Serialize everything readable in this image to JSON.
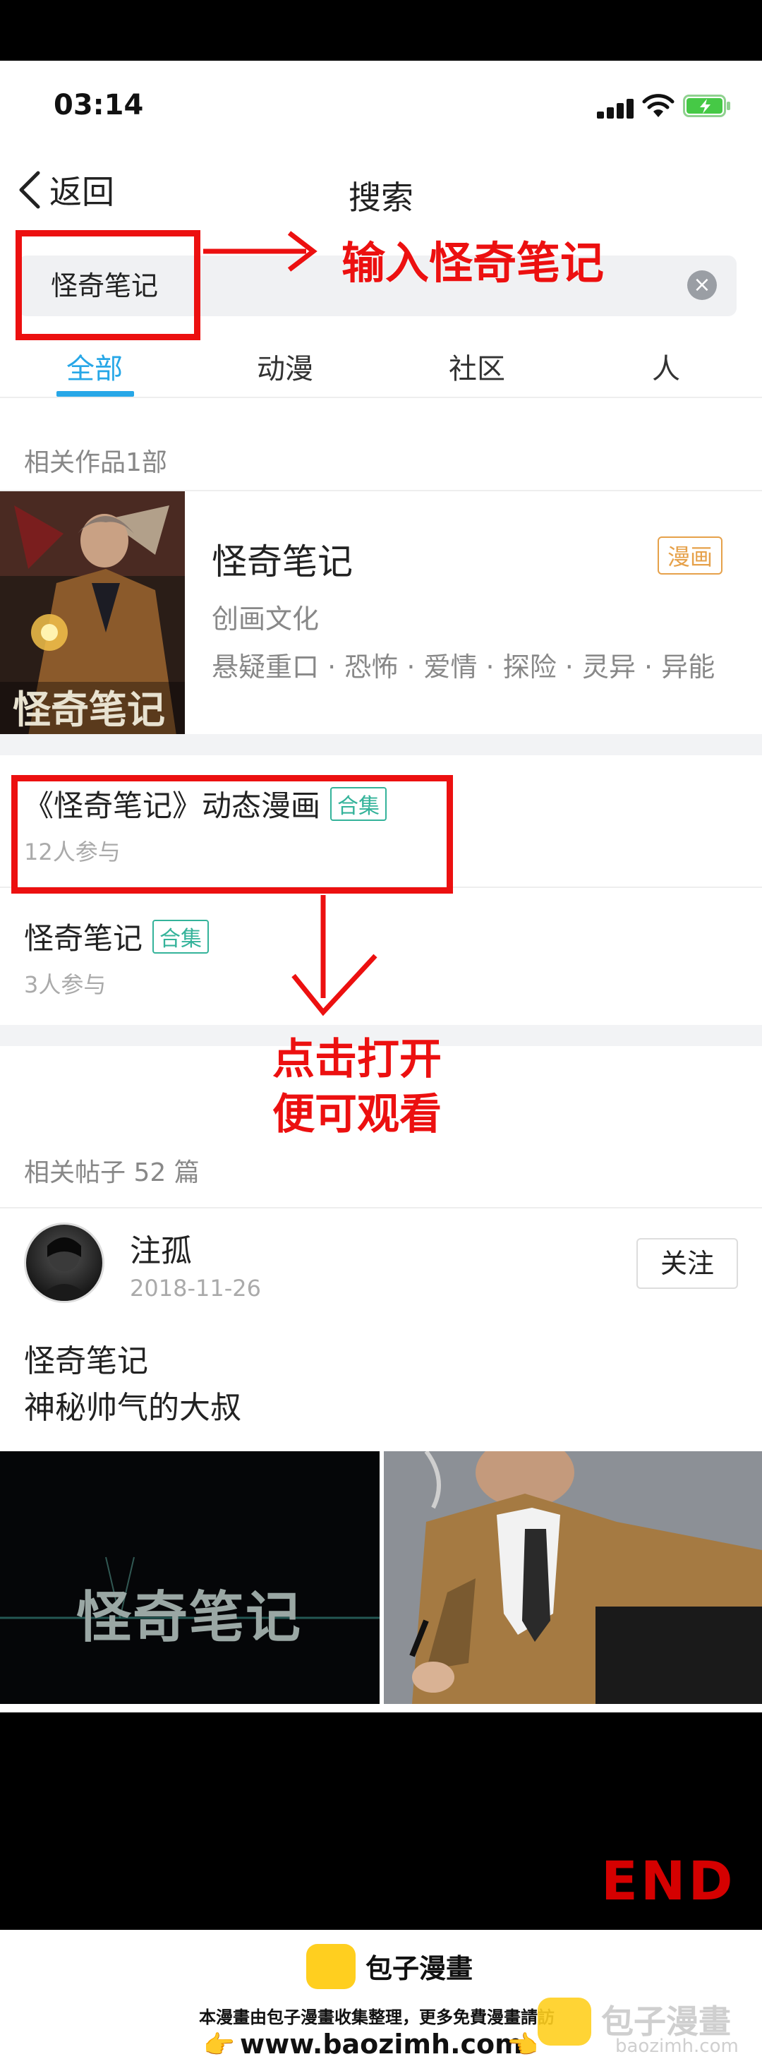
{
  "status_bar": {
    "time": "03:14"
  },
  "nav": {
    "back_label": "返回",
    "title": "搜索"
  },
  "search": {
    "query": "怪奇笔记"
  },
  "tabs": [
    {
      "label": "全部",
      "active": true
    },
    {
      "label": "动漫",
      "active": false
    },
    {
      "label": "社区",
      "active": false
    },
    {
      "label": "人",
      "active": false
    }
  ],
  "works_section": {
    "header": "相关作品1部"
  },
  "work": {
    "title": "怪奇笔记",
    "tag": "漫画",
    "author": "创画文化",
    "genres": "悬疑重口 · 恐怖 · 爱情 · 探险 · 灵异 · 异能",
    "cover_text": "怪奇笔记"
  },
  "collections": [
    {
      "title": "《怪奇笔记》动态漫画",
      "badge": "合集",
      "participants": "12人参与"
    },
    {
      "title": "怪奇笔记",
      "badge": "合集",
      "participants": "3人参与"
    }
  ],
  "posts_section": {
    "header": "相关帖子 52 篇"
  },
  "post": {
    "user": "注孤",
    "date": "2018-11-26",
    "follow_label": "关注",
    "line1": "怪奇笔记",
    "line2": "神秘帅气的大叔",
    "thumb_text": "怪奇笔记"
  },
  "annotations": {
    "input_note": "输入怪奇笔记",
    "open_note_1": "点击打开",
    "open_note_2": "便可观看",
    "color": "#ec1010"
  },
  "end_mark": "END",
  "footer": {
    "brand": "包子漫畫",
    "note": "本漫畫由包子漫畫收集整理，更多免費漫畫請訪",
    "url": "www.baozimh.com",
    "watermark_brand": "包子漫畫",
    "watermark_url": "baozimh.com"
  },
  "colors": {
    "accent": "#27a7e7",
    "tag_orange": "#e6a14a",
    "badge_green": "#34b39a"
  }
}
